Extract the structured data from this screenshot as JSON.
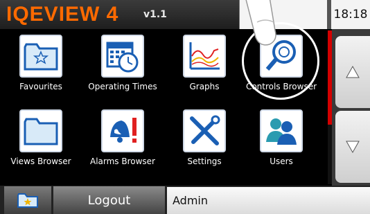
{
  "header": {
    "logo": "IQEVIEW 4",
    "version": "v1.1",
    "clock": "18:18"
  },
  "tiles": [
    {
      "label": "Favourites",
      "icon": "folder-star-icon"
    },
    {
      "label": "Operating Times",
      "icon": "calendar-clock-icon"
    },
    {
      "label": "Graphs",
      "icon": "line-graph-icon"
    },
    {
      "label": "Controls Browser",
      "icon": "magnifier-controller-icon"
    },
    {
      "label": "Views Browser",
      "icon": "folder-icon"
    },
    {
      "label": "Alarms Browser",
      "icon": "bell-alarm-icon"
    },
    {
      "label": "Settings",
      "icon": "wrench-screwdriver-icon"
    },
    {
      "label": "Users",
      "icon": "users-icon"
    }
  ],
  "footer": {
    "logout_label": "Logout",
    "user": "Admin"
  },
  "colors": {
    "brand": "#ff6a00",
    "scroll_indicator": "#d40000",
    "icon_blue": "#1a5fb4"
  }
}
